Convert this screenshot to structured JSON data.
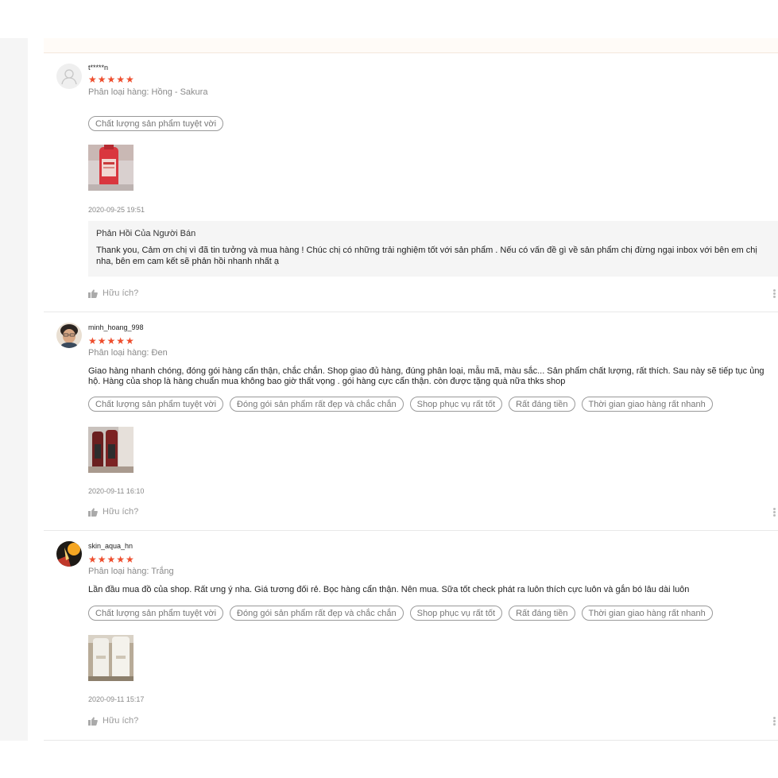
{
  "reviews": [
    {
      "username": "t*****n",
      "stars": "★★★★★",
      "variation": "Phân loại hàng: Hồng - Sakura",
      "comment": "",
      "tags": [
        "Chất lượng sản phẩm tuyệt vời"
      ],
      "time": "2020-09-25 19:51",
      "reply": {
        "title": "Phản Hồi Của Người Bán",
        "text": "Thank you, Cảm ơn chị vì đã tin tưởng và mua hàng ! Chúc chị có những trải nghiệm tốt với sản phẩm . Nếu có vấn đề gì về sản phẩm chị đừng ngại inbox với bên em chị nha, bên em cam kết sẽ phản hồi nhanh nhất ạ"
      },
      "helpful": "Hữu ích?"
    },
    {
      "username": "minh_hoang_998",
      "stars": "★★★★★",
      "variation": "Phân loại hàng: Đen",
      "comment": "Giao hàng nhanh chóng, đóng gói hàng cẩn thận, chắc chắn. Shop giao đủ hàng, đúng phân loại, mẫu mã, màu sắc... Sản phẩm chất lượng, rất thích. Sau này sẽ tiếp tục ủng hộ. Hàng của shop là hàng chuẩn mua không bao giờ thất vọng . gói hàng cực cẩn thận. còn được tặng quà nữa thks shop",
      "tags": [
        "Chất lượng sản phẩm tuyệt vời",
        "Đóng gói sản phẩm rất đẹp và chắc chắn",
        "Shop phục vụ rất tốt",
        "Rất đáng tiền",
        "Thời gian giao hàng rất nhanh"
      ],
      "time": "2020-09-11 16:10",
      "helpful": "Hữu ích?"
    },
    {
      "username": "skin_aqua_hn",
      "stars": "★★★★★",
      "variation": "Phân loại hàng: Trắng",
      "comment": "Lần đầu mua đồ của shop. Rất ưng ý nha. Giá tương đối rẻ. Bọc hàng cẩn thận. Nên mua. Sữa tốt check phát ra luôn thích cực luôn và gắn bó lâu dài luôn",
      "tags": [
        "Chất lượng sản phẩm tuyệt vời",
        "Đóng gói sản phẩm rất đẹp và chắc chắn",
        "Shop phục vụ rất tốt",
        "Rất đáng tiền",
        "Thời gian giao hàng rất nhanh"
      ],
      "time": "2020-09-11 15:17",
      "helpful": "Hữu ích?"
    }
  ],
  "colors": {
    "star": "#ee4d2d",
    "reply_bg": "#f5f5f5",
    "rail": "#f5f5f5"
  }
}
